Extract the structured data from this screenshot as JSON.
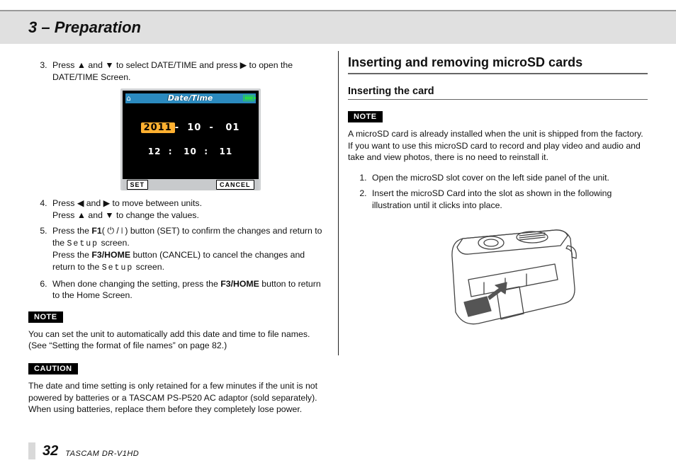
{
  "chapter": "3 – Preparation",
  "left": {
    "step3": "Press ▲ and ▼ to select DATE/TIME and press ▶ to open the DATE/TIME Screen.",
    "lcd": {
      "title": "Date/Time",
      "year": "2011",
      "month": "10",
      "day": "01",
      "hour": "12",
      "minute": "10",
      "second": "11",
      "btn_set": "SET",
      "btn_cancel": "CANCEL"
    },
    "step4a": "Press ◀ and ▶ to move between units.",
    "step4b": "Press ▲ and ▼ to change the values.",
    "step5a_pre": "Press the ",
    "step5a_bold": "F1",
    "step5a_post": "( ⏻ / ❘ ) button (SET) to confirm the changes and return to the ",
    "setup_text": "Setup",
    "step5a_tail": " screen.",
    "step5b_pre": "Press the ",
    "step5b_bold": "F3/HOME",
    "step5b_post": " button (CANCEL) to cancel the changes and return to the ",
    "step6_pre": "When done changing the setting, press the ",
    "step6_bold": "F3/HOME",
    "step6_post": " button to return to the Home Screen.",
    "note_label": "NOTE",
    "note_text": "You can set the unit to automatically add this date and time to file names. (See “Setting the format of file names” on page 82.)",
    "caution_label": "CAUTION",
    "caution_text": "The date and time setting is only retained for a few minutes if the unit is not powered by batteries or a TASCAM PS-P520 AC adaptor (sold separately). When using batteries, replace them before they completely lose power."
  },
  "right": {
    "section": "Inserting and removing microSD cards",
    "subsection": "Inserting the card",
    "note_label": "NOTE",
    "note_text": "A microSD card is already installed when the unit is shipped from the factory. If you want to use this microSD card to record and play video and audio and take and view photos, there is no need to reinstall it.",
    "step1": "Open the microSD slot cover on the left side panel of the unit.",
    "step2": "Insert the microSD Card into the slot as shown in the following illustration until it clicks into place."
  },
  "footer": {
    "page": "32",
    "model": "TASCAM  DR-V1HD"
  }
}
